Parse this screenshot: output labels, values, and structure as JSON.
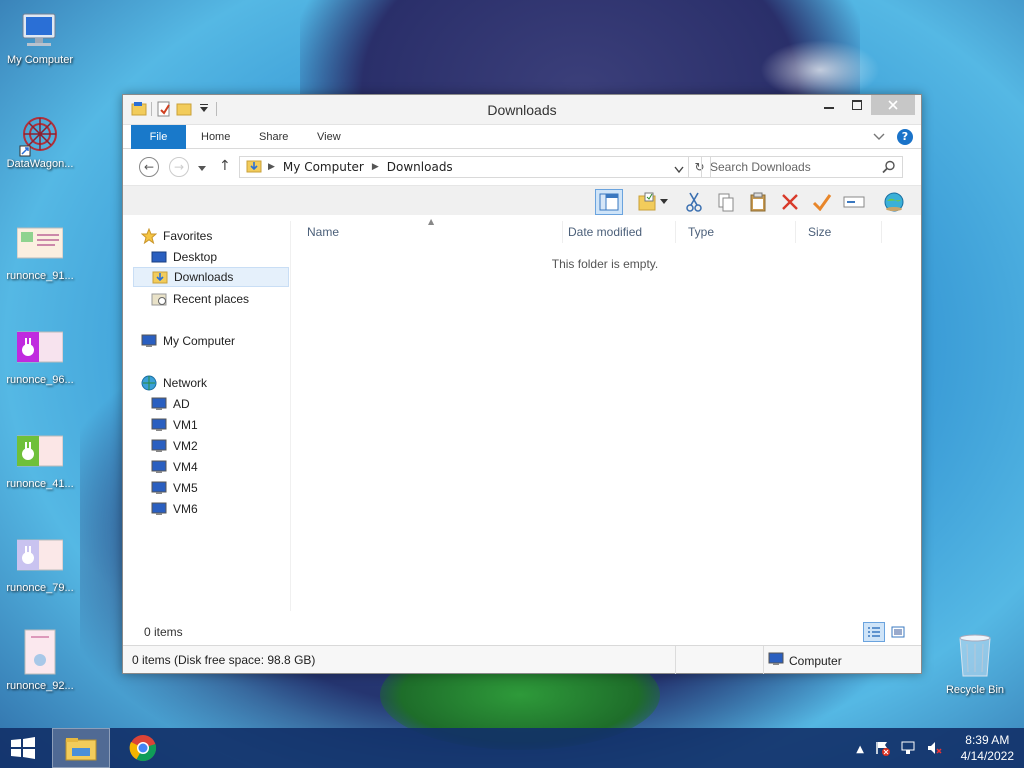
{
  "desktop": {
    "icons": [
      {
        "label": "My Computer",
        "icon": "computer-icon"
      },
      {
        "label": "DataWagon...",
        "icon": "datawagon-icon"
      },
      {
        "label": "runonce_91...",
        "icon": "image-file-icon"
      },
      {
        "label": "runonce_96...",
        "icon": "image-file-icon"
      },
      {
        "label": "runonce_41...",
        "icon": "image-file-icon"
      },
      {
        "label": "runonce_79...",
        "icon": "image-file-icon"
      },
      {
        "label": "runonce_92...",
        "icon": "image-file-icon"
      }
    ],
    "recycle_bin": {
      "label": "Recycle Bin",
      "icon": "recycle-bin-icon"
    }
  },
  "window": {
    "title": "Downloads",
    "ribbon_tabs": [
      "File",
      "Home",
      "Share",
      "View"
    ],
    "address": {
      "crumbs": [
        "My Computer",
        "Downloads"
      ]
    },
    "search": {
      "placeholder": "Search Downloads"
    },
    "nav": {
      "favorites": "Favorites",
      "favorite_items": [
        "Desktop",
        "Downloads",
        "Recent places"
      ],
      "selected": "Downloads",
      "computer": "My Computer",
      "network": "Network",
      "network_items": [
        "AD",
        "VM1",
        "VM2",
        "VM4",
        "VM5",
        "VM6"
      ]
    },
    "columns": [
      "Name",
      "Date modified",
      "Type",
      "Size"
    ],
    "empty_message": "This folder is empty.",
    "item_count": "0 items",
    "status": {
      "left": "0 items (Disk free space: 98.8 GB)",
      "right": "Computer"
    }
  },
  "taskbar": {
    "time": "8:39 AM",
    "date": "4/14/2022",
    "pinned": [
      "file-explorer-icon",
      "chrome-icon"
    ]
  },
  "colors": {
    "accent": "#1979ca",
    "taskbar": "#123068"
  }
}
